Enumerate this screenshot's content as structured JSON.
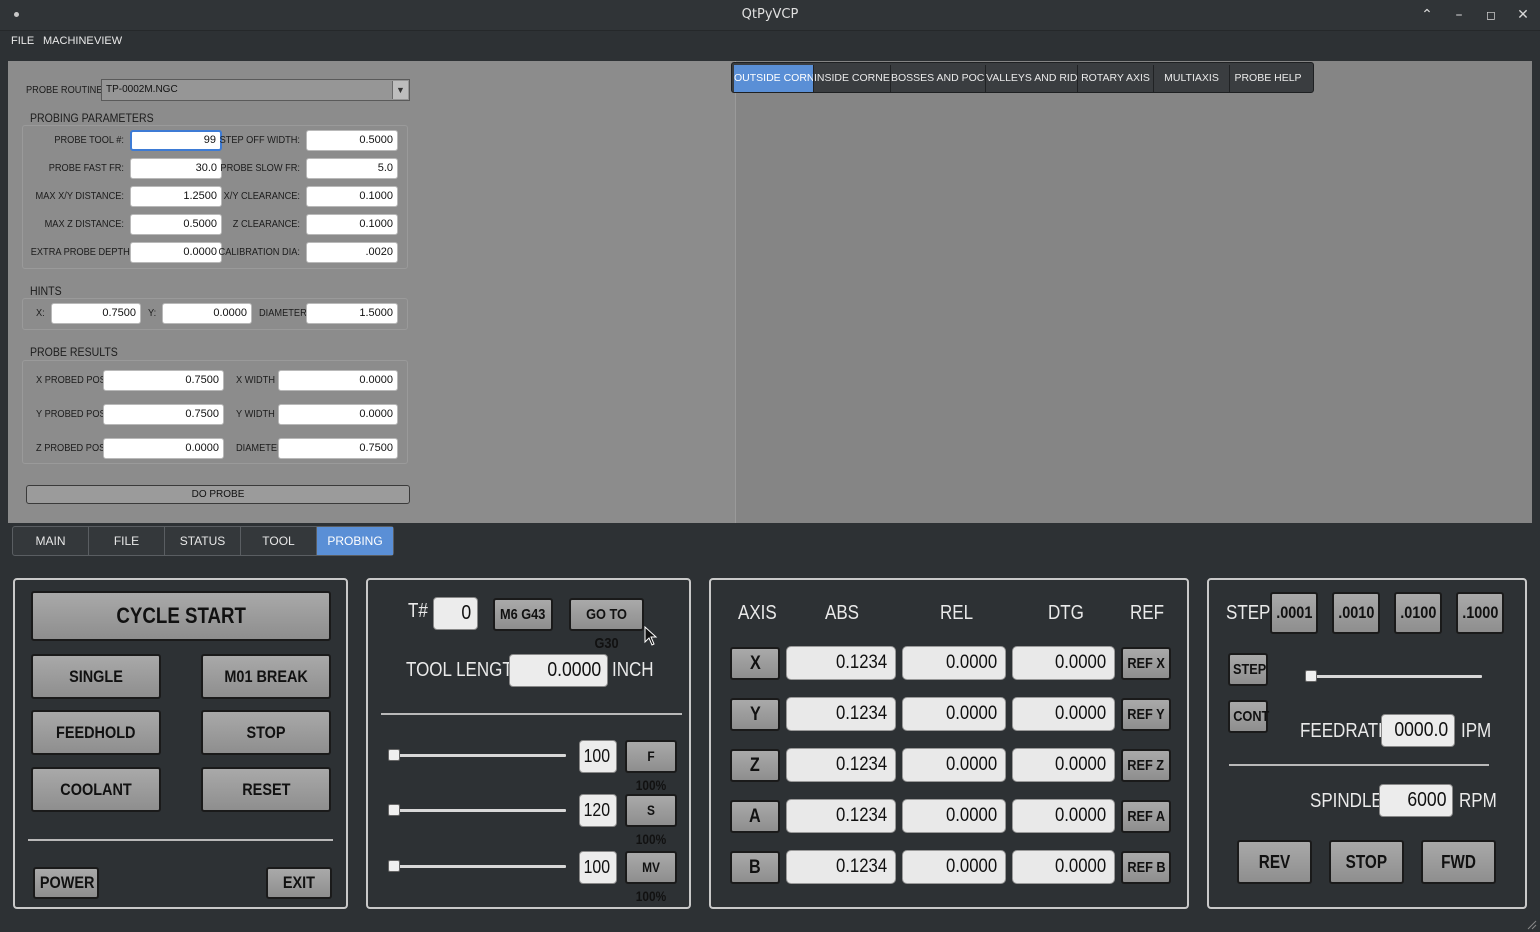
{
  "window": {
    "title": "QtPyVCP"
  },
  "menu": [
    "FILE",
    "MACHINE",
    "VIEW"
  ],
  "probe": {
    "routine_label": "PROBE ROUTINE:",
    "routine_value": "TP-0002M.NGC",
    "params_title": "PROBING PARAMETERS",
    "params": [
      {
        "label": "PROBE TOOL #:",
        "value": "99"
      },
      {
        "label": "STEP OFF WIDTH:",
        "value": "0.5000"
      },
      {
        "label": "PROBE FAST FR:",
        "value": "30.0"
      },
      {
        "label": "PROBE SLOW FR:",
        "value": "5.0"
      },
      {
        "label": "MAX X/Y DISTANCE:",
        "value": "1.2500"
      },
      {
        "label": "X/Y CLEARANCE:",
        "value": "0.1000"
      },
      {
        "label": "MAX Z DISTANCE:",
        "value": "0.5000"
      },
      {
        "label": "Z CLEARANCE:",
        "value": "0.1000"
      },
      {
        "label": "EXTRA PROBE DEPTH:",
        "value": "0.0000"
      },
      {
        "label": "CALIBRATION DIA:",
        "value": ".0020"
      }
    ],
    "hints_title": "HINTS",
    "hints": {
      "x_label": "X:",
      "x": "0.7500",
      "y_label": "Y:",
      "y": "0.0000",
      "dia_label": "DIAMETER",
      "dia": "1.5000"
    },
    "results_title": "PROBE RESULTS",
    "results": [
      {
        "label": "X PROBED POS:",
        "value": "0.7500",
        "label2": "X WIDTH",
        "value2": "0.0000"
      },
      {
        "label": "Y PROBED POS:",
        "value": "0.7500",
        "label2": "Y WIDTH",
        "value2": "0.0000"
      },
      {
        "label": "Z PROBED POS:",
        "value": "0.0000",
        "label2": "DIAMETER",
        "value2": "0.7500"
      }
    ],
    "do_probe": "DO PROBE",
    "tabs": [
      "OUTSIDE CORNERS",
      "INSIDE CORNERS",
      "BOSSES AND POCKETS",
      "VALLEYS AND RIDGES",
      "ROTARY AXIS",
      "MULTIAXIS",
      "PROBE HELP"
    ],
    "active_tab": "OUTSIDE CORNERS"
  },
  "main_tabs": [
    "MAIN",
    "FILE",
    "STATUS",
    "TOOL",
    "PROBING"
  ],
  "active_main_tab": "PROBING",
  "control": {
    "cycle_start": "CYCLE START",
    "single_block": "SINGLE BLOCK",
    "m01_break": "M01 BREAK",
    "feedhold": "FEEDHOLD",
    "stop": "STOP",
    "coolant": "COOLANT",
    "reset": "RESET",
    "power": "POWER",
    "exit": "EXIT"
  },
  "tool": {
    "t_label": "T#",
    "t_value": "0",
    "m6g43": "M6 G43",
    "goto_g30": "GO TO G30",
    "length_label": "TOOL LENGTH",
    "length_value": "0.0000",
    "length_unit": "INCH",
    "overrides": [
      {
        "value": "100",
        "button": "F 100%",
        "level": 0
      },
      {
        "value": "120",
        "button": "S 100%",
        "level": 0
      },
      {
        "value": "100",
        "button": "MV 100%",
        "level": 0
      }
    ]
  },
  "dro": {
    "headers": [
      "AXIS",
      "ABS",
      "REL",
      "DTG",
      "REF"
    ],
    "rows": [
      {
        "axis": "X",
        "abs": "0.1234",
        "rel": "0.0000",
        "dtg": "0.0000",
        "ref": "REF X"
      },
      {
        "axis": "Y",
        "abs": "0.1234",
        "rel": "0.0000",
        "dtg": "0.0000",
        "ref": "REF Y"
      },
      {
        "axis": "Z",
        "abs": "0.1234",
        "rel": "0.0000",
        "dtg": "0.0000",
        "ref": "REF Z"
      },
      {
        "axis": "A",
        "abs": "0.1234",
        "rel": "0.0000",
        "dtg": "0.0000",
        "ref": "REF A"
      },
      {
        "axis": "B",
        "abs": "0.1234",
        "rel": "0.0000",
        "dtg": "0.0000",
        "ref": "REF B"
      }
    ]
  },
  "jog": {
    "step_label": "STEP",
    "steps": [
      ".0001",
      ".0010",
      ".0100",
      ".1000"
    ],
    "step_btn": "STEP",
    "cont_btn": "CONT",
    "feed_label": "FEEDRATE",
    "feed_value": "0000.0",
    "feed_unit": "IPM",
    "feed_level": 0,
    "spindle_label": "SPINDLE",
    "spindle_value": "6000",
    "spindle_unit": "RPM",
    "rev": "REV",
    "stop": "STOP",
    "fwd": "FWD"
  }
}
